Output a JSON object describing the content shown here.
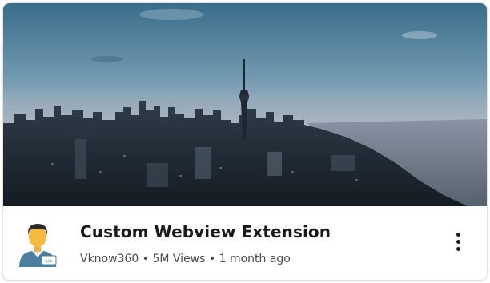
{
  "video": {
    "title": "Custom Webview Extension",
    "channel": "Vknow360",
    "views": "5M Views",
    "age": "1 month ago",
    "separator": "•"
  },
  "thumbnail": {
    "description_icon": "city-skyline-thumbnail"
  },
  "avatar": {
    "icon": "developer-avatar-icon",
    "badge_text": "</>"
  },
  "menu": {
    "icon": "more-vertical-icon"
  },
  "colors": {
    "title": "#1a1a1a",
    "meta": "#4a4a4a",
    "sky_top": "#3d6f8c",
    "sky_bottom": "#d9c4c8"
  }
}
